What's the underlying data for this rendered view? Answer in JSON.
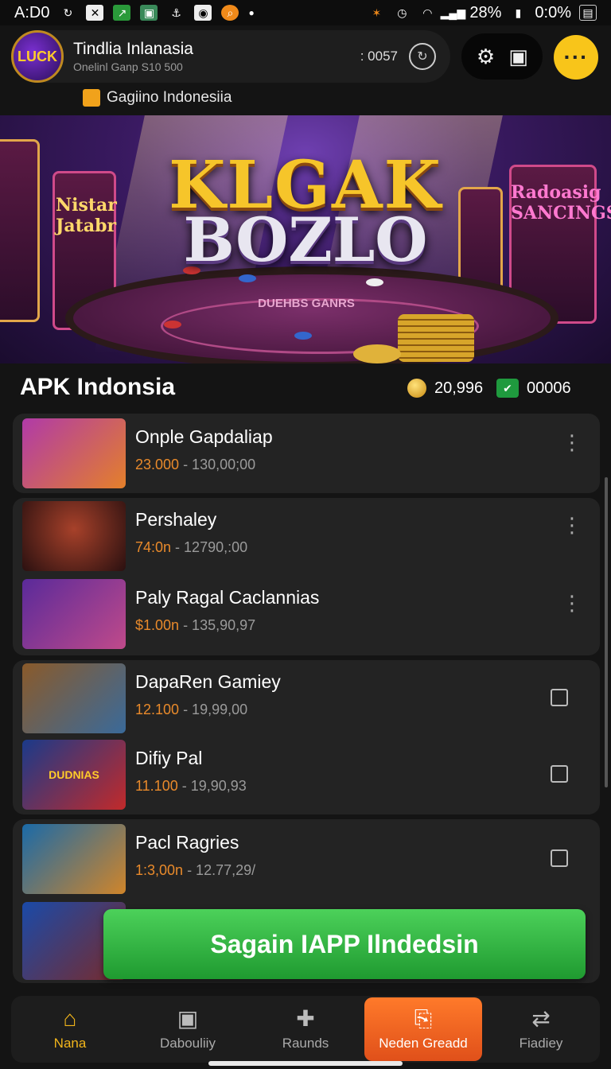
{
  "status_bar": {
    "time": "A:D0",
    "battery_pct": "28%",
    "clock_right": "0:0%"
  },
  "header": {
    "logo_text": "LUCK",
    "title": "Tindlia Inlanasia",
    "subtitle": "Onelinl Ganp  S10 500",
    "count": ": 0057",
    "more_label": "···"
  },
  "breadcrumb": {
    "label": "Gagiino Indonesiia"
  },
  "banner": {
    "title_line1": "KLGAK",
    "title_line2": "BOZLO",
    "sign_left": "Nistar Jatabr",
    "sign_right": "Radoasig SANCINGS",
    "table_text": "DUEHBS GANRS"
  },
  "section": {
    "title": "APK Indonsia",
    "coins": "20,996",
    "gems": "00006"
  },
  "games": [
    {
      "title": "Onple Gapdaliap",
      "price": "23.000",
      "detail": " - 130,00;00",
      "control": "more"
    },
    {
      "title": "Pershaley",
      "price": "74:0n",
      "detail": " - 12790,:00",
      "control": "more"
    },
    {
      "title": "Paly Ragal Caclannias",
      "price": "$1.00n",
      "detail": " - 135,90,97",
      "control": "more"
    },
    {
      "title": "DapaRen Gamiey",
      "price": "12.100",
      "detail": "  - 19,99,00",
      "control": "check"
    },
    {
      "title": "Difiy Pal",
      "price": "11.100",
      "detail": "  - 19,90,93",
      "control": "check"
    },
    {
      "title": "Pacl Ragries",
      "price": "1:3,00n",
      "detail": " - 12.77,29/",
      "control": "check"
    }
  ],
  "thumb_labels": [
    "",
    "",
    "",
    "",
    "DUDNIAS",
    "",
    ""
  ],
  "cta": {
    "label": "Sagain IAPP Ilndedsin"
  },
  "nav": [
    {
      "label": "Nana",
      "icon": "home-icon",
      "state": "active"
    },
    {
      "label": "Dabouliiy",
      "icon": "box-icon",
      "state": ""
    },
    {
      "label": "Raunds",
      "icon": "puzzle-icon",
      "state": ""
    },
    {
      "label": "Neden Greadd",
      "icon": "gift-icon",
      "state": "highlight"
    },
    {
      "label": "Fiadiey",
      "icon": "swap-icon",
      "state": ""
    }
  ],
  "colors": {
    "accent": "#f2b51b",
    "price": "#e98a2b",
    "cta": "#2fb840",
    "nav_highlight": "#ff7a2a"
  }
}
